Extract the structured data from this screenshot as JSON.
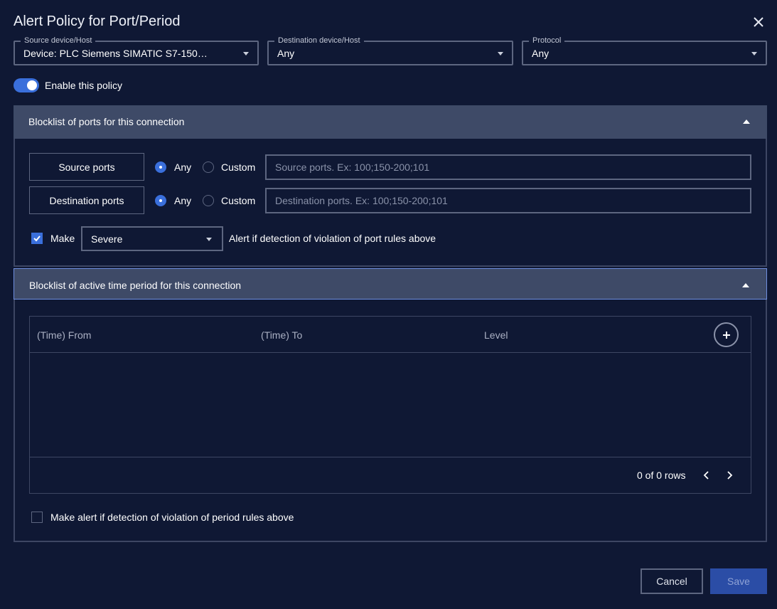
{
  "dialog": {
    "title": "Alert Policy for Port/Period"
  },
  "filters": {
    "source": {
      "legend": "Source device/Host",
      "value": "Device: PLC Siemens SIMATIC S7-150…"
    },
    "destination": {
      "legend": "Destination device/Host",
      "value": "Any"
    },
    "protocol": {
      "legend": "Protocol",
      "value": "Any"
    }
  },
  "enable": {
    "label": "Enable this policy",
    "on": true
  },
  "ports_section": {
    "title": "Blocklist of ports for this connection",
    "source": {
      "label": "Source ports",
      "any": "Any",
      "custom": "Custom",
      "placeholder": "Source ports. Ex: 100;150-200;101"
    },
    "destination": {
      "label": "Destination ports",
      "any": "Any",
      "custom": "Custom",
      "placeholder": "Destination ports. Ex: 100;150-200;101"
    },
    "make_label": "Make",
    "severity": "Severe",
    "alert_text": "Alert if detection of violation of port rules above"
  },
  "period_section": {
    "title": "Blocklist of active time period for this connection",
    "columns": [
      "(Time) From",
      "(Time) To",
      "Level"
    ],
    "rows_text": "0 of 0 rows",
    "alert_text": "Make alert if detection of violation of period rules above"
  },
  "actions": {
    "cancel": "Cancel",
    "save": "Save"
  },
  "colors": {
    "accent": "#3a6fdb",
    "background": "#0f1834",
    "header": "#3e4a67"
  }
}
